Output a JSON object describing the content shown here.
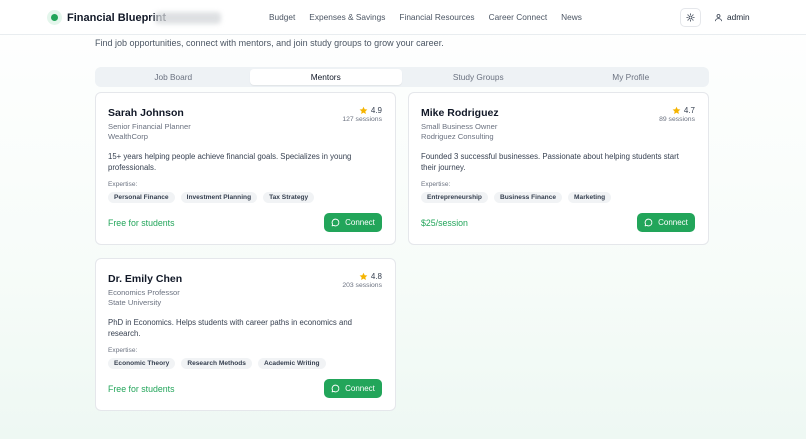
{
  "header": {
    "brand": "Financial Blueprint",
    "nav": [
      "Budget",
      "Expenses & Savings",
      "Financial Resources",
      "Career Connect",
      "News"
    ],
    "user": "admin"
  },
  "subtitle": "Find job opportunities, connect with mentors, and join study groups to grow your career.",
  "tabs": [
    {
      "label": "Job Board",
      "active": false
    },
    {
      "label": "Mentors",
      "active": true
    },
    {
      "label": "Study Groups",
      "active": false
    },
    {
      "label": "My Profile",
      "active": false
    }
  ],
  "expertise_label": "Expertise:",
  "connect_label": "Connect",
  "mentors": [
    {
      "name": "Sarah Johnson",
      "role": "Senior Financial Planner",
      "company": "WealthCorp",
      "rating": "4.9",
      "sessions": "127 sessions",
      "description": "15+ years helping people achieve financial goals. Specializes in young professionals.",
      "expertise": [
        "Personal Finance",
        "Investment Planning",
        "Tax Strategy"
      ],
      "price": "Free for students"
    },
    {
      "name": "Mike Rodriguez",
      "role": "Small Business Owner",
      "company": "Rodriguez Consulting",
      "rating": "4.7",
      "sessions": "89 sessions",
      "description": "Founded 3 successful businesses. Passionate about helping students start their journey.",
      "expertise": [
        "Entrepreneurship",
        "Business Finance",
        "Marketing"
      ],
      "price": "$25/session"
    },
    {
      "name": "Dr. Emily Chen",
      "role": "Economics Professor",
      "company": "State University",
      "rating": "4.8",
      "sessions": "203 sessions",
      "description": "PhD in Economics. Helps students with career paths in economics and research.",
      "expertise": [
        "Economic Theory",
        "Research Methods",
        "Academic Writing"
      ],
      "price": "Free for students"
    }
  ],
  "colors": {
    "accent": "#22a55a",
    "star": "#f5b400"
  },
  "icons": {
    "theme": "sun-icon",
    "user": "user-icon",
    "rating": "star-icon",
    "connect": "chat-bubble-icon"
  }
}
